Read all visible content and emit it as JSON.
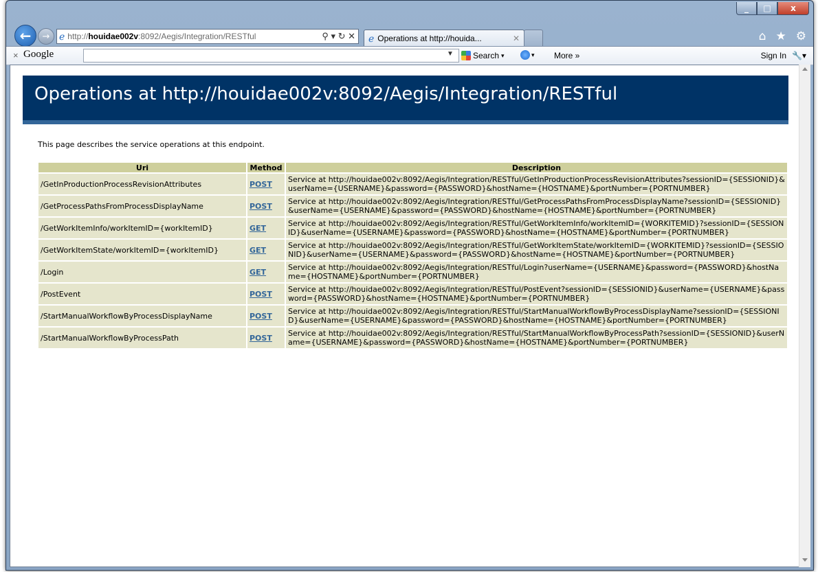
{
  "browser": {
    "address_prefix": "http://",
    "address_host": "houidae002v",
    "address_rest": ":8092/Aegis/Integration/RESTful",
    "tab_title": "Operations at http://houida...",
    "window_buttons": [
      "_",
      "□",
      "x"
    ]
  },
  "google_toolbar": {
    "logo": "Google",
    "search_label": "Search",
    "more_label": "More »",
    "sign_in_label": "Sign In"
  },
  "page": {
    "title": "Operations at http://houidae002v:8092/Aegis/Integration/RESTful",
    "intro": "This page describes the service operations at this endpoint.",
    "columns": [
      "Uri",
      "Method",
      "Description"
    ],
    "rows": [
      {
        "uri": "/GetInProductionProcessRevisionAttributes",
        "method": "POST",
        "description": "Service at http://houidae002v:8092/Aegis/Integration/RESTful/GetInProductionProcessRevisionAttributes?sessionID={SESSIONID}&userName={USERNAME}&password={PASSWORD}&hostName={HOSTNAME}&portNumber={PORTNUMBER}"
      },
      {
        "uri": "/GetProcessPathsFromProcessDisplayName",
        "method": "POST",
        "description": "Service at http://houidae002v:8092/Aegis/Integration/RESTful/GetProcessPathsFromProcessDisplayName?sessionID={SESSIONID}&userName={USERNAME}&password={PASSWORD}&hostName={HOSTNAME}&portNumber={PORTNUMBER}"
      },
      {
        "uri": "/GetWorkItemInfo/workItemID={workItemID}",
        "method": "GET",
        "description": "Service at http://houidae002v:8092/Aegis/Integration/RESTful/GetWorkItemInfo/workItemID={WORKITEMID}?sessionID={SESSIONID}&userName={USERNAME}&password={PASSWORD}&hostName={HOSTNAME}&portNumber={PORTNUMBER}"
      },
      {
        "uri": "/GetWorkItemState/workItemID={workItemID}",
        "method": "GET",
        "description": "Service at http://houidae002v:8092/Aegis/Integration/RESTful/GetWorkItemState/workItemID={WORKITEMID}?sessionID={SESSIONID}&userName={USERNAME}&password={PASSWORD}&hostName={HOSTNAME}&portNumber={PORTNUMBER}"
      },
      {
        "uri": "/Login",
        "method": "GET",
        "description": "Service at http://houidae002v:8092/Aegis/Integration/RESTful/Login?userName={USERNAME}&password={PASSWORD}&hostName={HOSTNAME}&portNumber={PORTNUMBER}"
      },
      {
        "uri": "/PostEvent",
        "method": "POST",
        "description": "Service at http://houidae002v:8092/Aegis/Integration/RESTful/PostEvent?sessionID={SESSIONID}&userName={USERNAME}&password={PASSWORD}&hostName={HOSTNAME}&portNumber={PORTNUMBER}"
      },
      {
        "uri": "/StartManualWorkflowByProcessDisplayName",
        "method": "POST",
        "description": "Service at http://houidae002v:8092/Aegis/Integration/RESTful/StartManualWorkflowByProcessDisplayName?sessionID={SESSIONID}&userName={USERNAME}&password={PASSWORD}&hostName={HOSTNAME}&portNumber={PORTNUMBER}"
      },
      {
        "uri": "/StartManualWorkflowByProcessPath",
        "method": "POST",
        "description": "Service at http://houidae002v:8092/Aegis/Integration/RESTful/StartManualWorkflowByProcessPath?sessionID={SESSIONID}&userName={USERNAME}&password={PASSWORD}&hostName={HOSTNAME}&portNumber={PORTNUMBER}"
      }
    ]
  },
  "colors": {
    "header_bg": "#003366",
    "header_border": "#336699",
    "table_header_bg": "#cecf9c",
    "table_cell_bg": "#e5e5cc",
    "link": "#336699"
  },
  "icons": [
    "back-arrow-icon",
    "forward-arrow-icon",
    "ie-logo-icon",
    "home-icon",
    "favorites-star-icon",
    "tools-gear-icon",
    "wrench-icon"
  ]
}
